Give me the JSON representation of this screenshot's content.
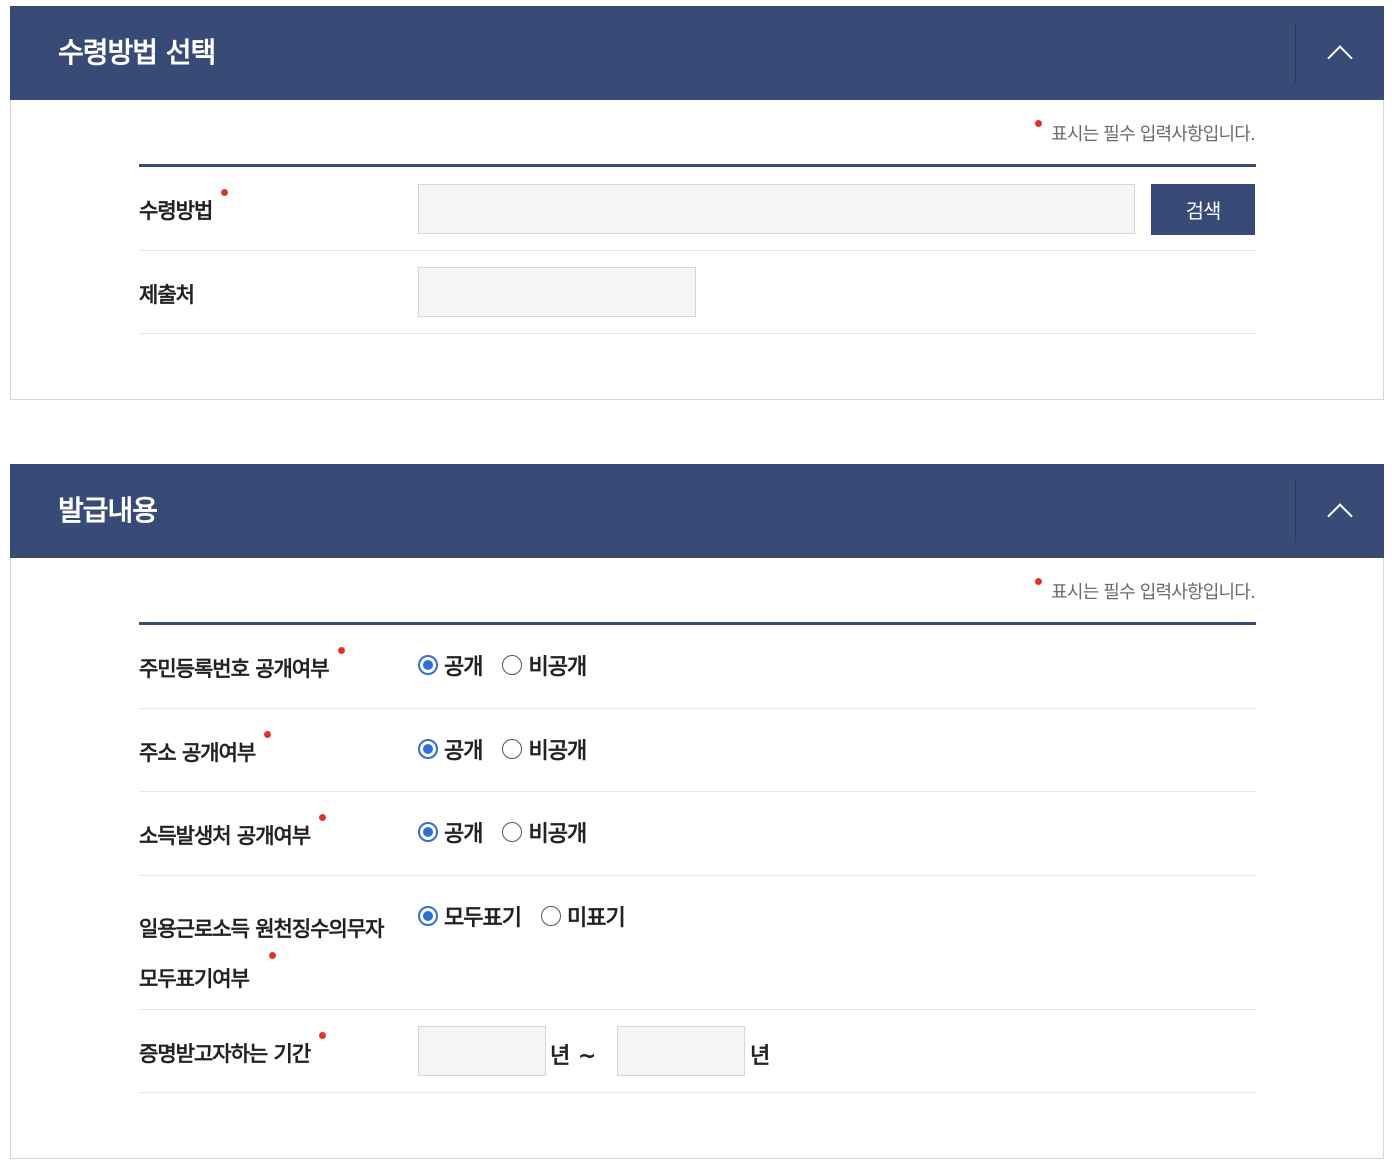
{
  "colors": {
    "header": "#384b76",
    "required": "#e2332b",
    "input_bg": "#f5f5f5",
    "radio": "#2f6fd6"
  },
  "section1": {
    "title": "수령방법 선택",
    "required_note": "표시는 필수 입력사항입니다.",
    "rows": [
      {
        "label": "수령방법",
        "required": true,
        "button": "검색"
      },
      {
        "label": "제출처",
        "required": false
      }
    ]
  },
  "section2": {
    "title": "발급내용",
    "required_note": "표시는 필수 입력사항입니다.",
    "rows": [
      {
        "label": "주민등록번호 공개여부",
        "options": [
          "공개",
          "비공개"
        ],
        "selected": "공개"
      },
      {
        "label": "주소 공개여부",
        "options": [
          "공개",
          "비공개"
        ],
        "selected": "공개"
      },
      {
        "label": "소득발생처 공개여부",
        "options": [
          "공개",
          "비공개"
        ],
        "selected": "공개"
      },
      {
        "label_line1": "일용근로소득 원천징수의무자",
        "label_line2": "모두표기여부",
        "options": [
          "모두표기",
          "미표기"
        ],
        "selected": "모두표기"
      },
      {
        "label": "증명받고자하는 기간",
        "unit_from": "년 ~",
        "unit_to": "년"
      }
    ]
  }
}
